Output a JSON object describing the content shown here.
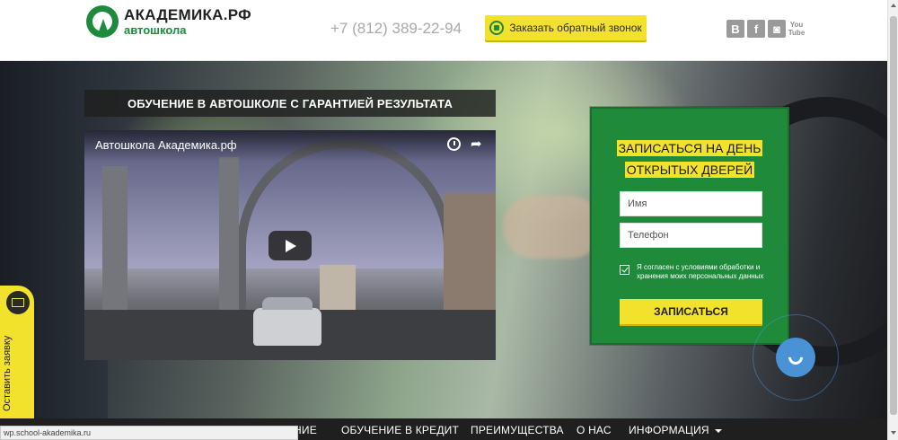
{
  "header": {
    "logo_title": "АКАДЕМИКА.РФ",
    "logo_subtitle": "автошкола",
    "phone": "+7 (812) 389-22-94",
    "callback_label": "Заказать обратный звонок",
    "social": [
      {
        "icon": "vk-icon",
        "glyph": "B"
      },
      {
        "icon": "facebook-icon",
        "glyph": "f"
      },
      {
        "icon": "instagram-icon",
        "glyph": "◙"
      },
      {
        "icon": "youtube-icon",
        "glyph": "You\nTube"
      }
    ]
  },
  "hero": {
    "banner_title": "ОБУЧЕНИЕ В АВТОШКОЛЕ С ГАРАНТИЕЙ РЕЗУЛЬТАТА",
    "video": {
      "caption": "Автошкола Академика.рф"
    }
  },
  "form": {
    "title_line1": "ЗАПИСАТЬСЯ НА ДЕНЬ",
    "title_line2": "ОТКРЫТЫХ ДВЕРЕЙ",
    "name_placeholder": "Имя",
    "phone_placeholder": "Телефон",
    "consent_text": "Я согласен с условиями обработки и хранения моих персональных данных",
    "consent_checked": true,
    "submit_label": "ЗАПИСАТЬСЯ"
  },
  "side_tab": {
    "label": "Оставить заявку"
  },
  "nav": {
    "items": [
      {
        "label": "НИЕ"
      },
      {
        "label": "ОБУЧЕНИЕ В КРЕДИТ"
      },
      {
        "label": "ПРЕИМУЩЕСТВА"
      },
      {
        "label": "О НАС"
      },
      {
        "label": "ИНФОРМАЦИЯ"
      }
    ]
  },
  "status_bar": {
    "url": "wp.school-akademika.ru"
  },
  "colors": {
    "brand_green": "#1e8a3a",
    "accent_yellow": "#f3e22c",
    "nav_bg": "#1f1f1f",
    "call_blue": "#4a92d6"
  }
}
